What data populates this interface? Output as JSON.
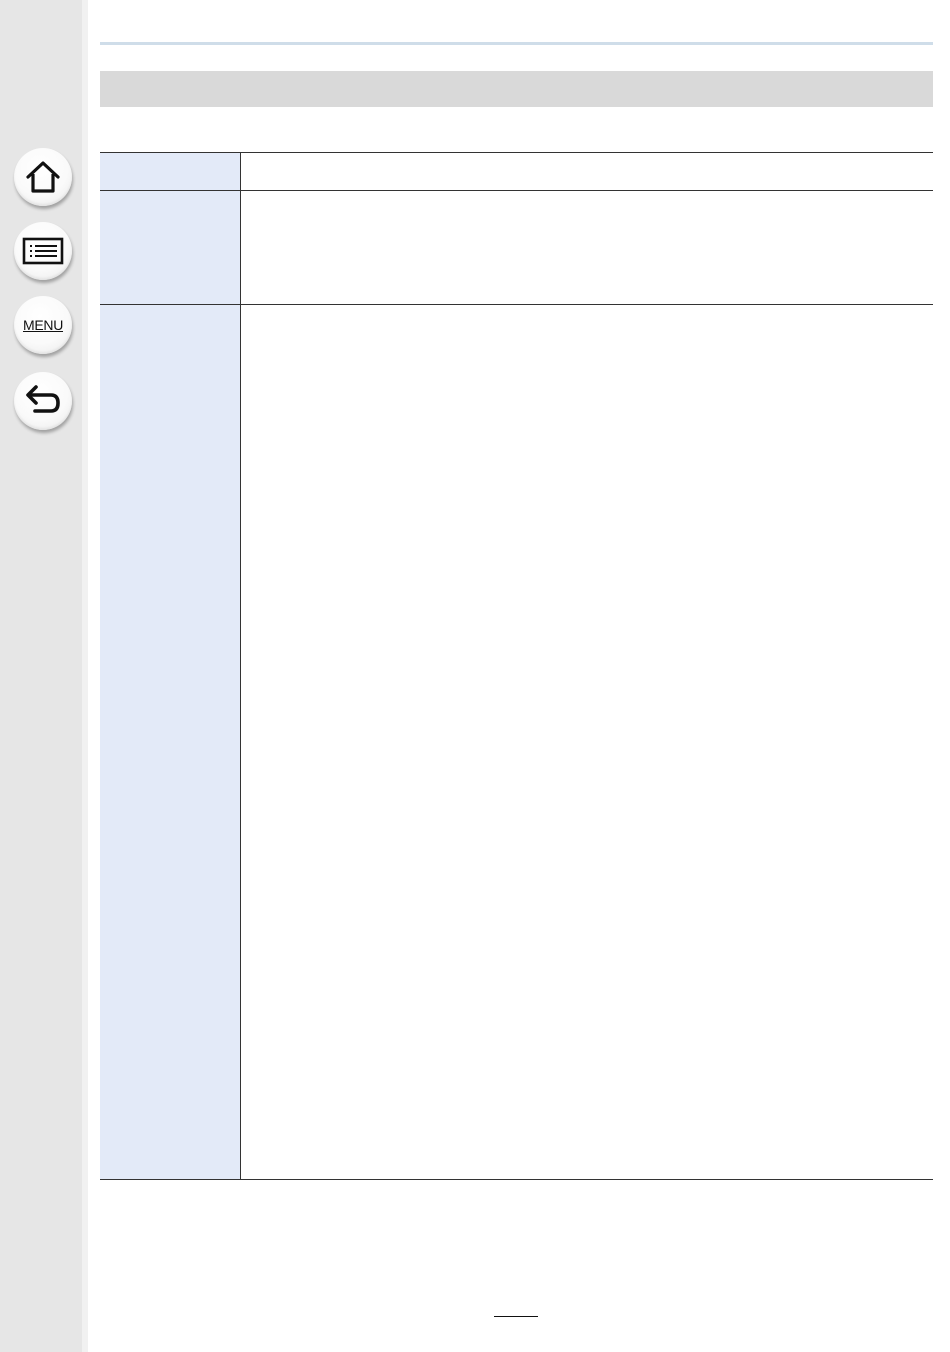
{
  "navigation": {
    "home_icon": "home-icon",
    "contents_icon": "table-of-contents-icon",
    "menu_label": "MENU",
    "back_icon": "back-arrow-icon"
  },
  "colors": {
    "rail": "#e6e6e6",
    "title_bar": "#d9d9d9",
    "label_cell": "#e3eaf8",
    "top_rule": "#cfdde9"
  },
  "document": {
    "section_title": "",
    "table": {
      "rows": [
        {
          "label": "",
          "value": ""
        },
        {
          "label": "",
          "value": ""
        },
        {
          "label": "",
          "value": ""
        }
      ]
    },
    "page_number": ""
  }
}
